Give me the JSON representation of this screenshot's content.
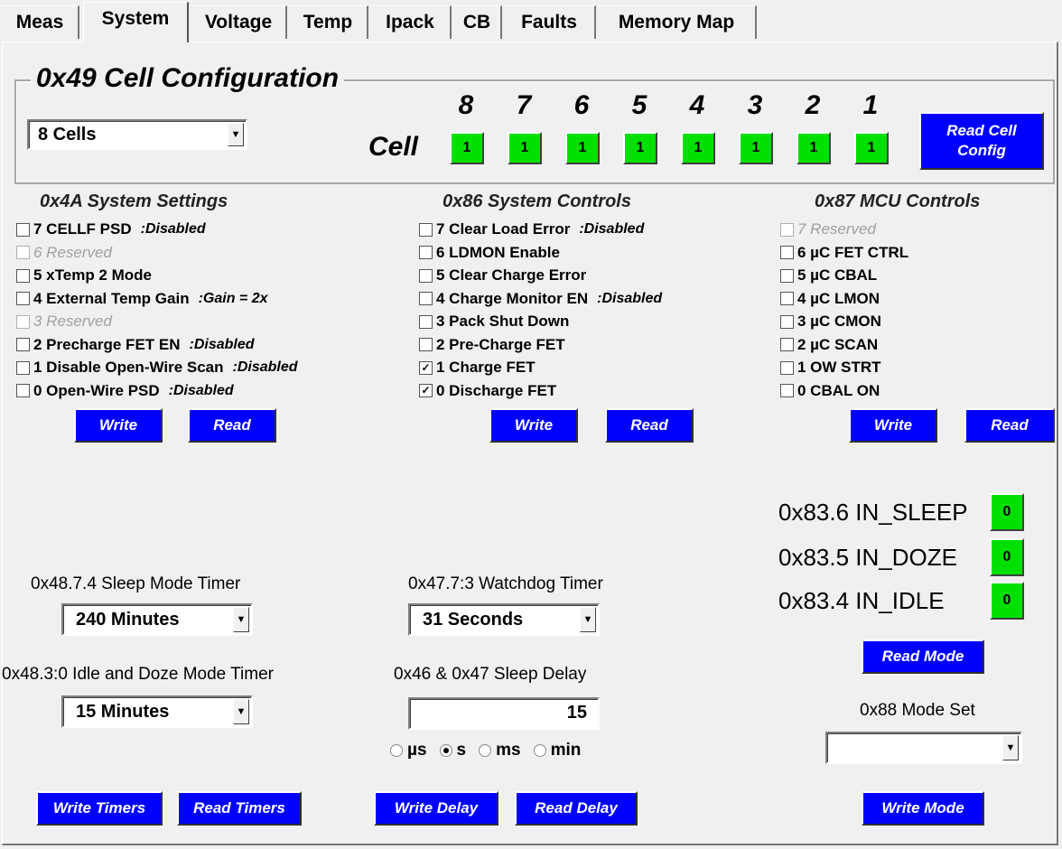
{
  "tabs": [
    "Meas",
    "System",
    "Voltage",
    "Temp",
    "Ipack",
    "CB",
    "Faults",
    "Memory Map"
  ],
  "active_tab": "System",
  "cell_config": {
    "title": "0x49 Cell Configuration",
    "cells_select": "8 Cells",
    "cell_label": "Cell",
    "cell_numbers": [
      "8",
      "7",
      "6",
      "5",
      "4",
      "3",
      "2",
      "1"
    ],
    "cell_values": [
      "1",
      "1",
      "1",
      "1",
      "1",
      "1",
      "1",
      "1"
    ],
    "read_button": "Read Cell Config"
  },
  "system_settings": {
    "title": "0x4A System Settings",
    "items": [
      {
        "label": "7 CELLF PSD",
        "note": ":Disabled",
        "checked": false,
        "disabled": false
      },
      {
        "label": "6 Reserved",
        "note": "",
        "checked": false,
        "disabled": true
      },
      {
        "label": "5 xTemp 2 Mode",
        "note": "",
        "checked": false,
        "disabled": false
      },
      {
        "label": "4 External Temp Gain",
        "note": ":Gain = 2x",
        "checked": false,
        "disabled": false
      },
      {
        "label": "3 Reserved",
        "note": "",
        "checked": false,
        "disabled": true
      },
      {
        "label": "2 Precharge FET EN",
        "note": ":Disabled",
        "checked": false,
        "disabled": false
      },
      {
        "label": "1 Disable Open-Wire Scan",
        "note": ":Disabled",
        "checked": false,
        "disabled": false
      },
      {
        "label": "0 Open-Wire PSD",
        "note": ":Disabled",
        "checked": false,
        "disabled": false
      }
    ],
    "write": "Write",
    "read": "Read"
  },
  "system_controls": {
    "title": "0x86 System Controls",
    "items": [
      {
        "label": "7 Clear Load Error",
        "note": ":Disabled",
        "checked": false,
        "disabled": false
      },
      {
        "label": "6 LDMON Enable",
        "note": "",
        "checked": false,
        "disabled": false
      },
      {
        "label": "5 Clear Charge Error",
        "note": "",
        "checked": false,
        "disabled": false
      },
      {
        "label": "4 Charge Monitor EN",
        "note": ":Disabled",
        "checked": false,
        "disabled": false
      },
      {
        "label": "3 Pack Shut Down",
        "note": "",
        "checked": false,
        "disabled": false
      },
      {
        "label": "2 Pre-Charge FET",
        "note": "",
        "checked": false,
        "disabled": false
      },
      {
        "label": "1 Charge FET",
        "note": "",
        "checked": true,
        "disabled": false
      },
      {
        "label": "0 Discharge FET",
        "note": "",
        "checked": true,
        "disabled": false
      }
    ],
    "write": "Write",
    "read": "Read"
  },
  "mcu_controls": {
    "title": "0x87 MCU Controls",
    "items": [
      {
        "label": "7 Reserved",
        "note": "",
        "checked": false,
        "disabled": true
      },
      {
        "label": "6 µC FET CTRL",
        "note": "",
        "checked": false,
        "disabled": false
      },
      {
        "label": "5 µC CBAL",
        "note": "",
        "checked": false,
        "disabled": false
      },
      {
        "label": "4 µC LMON",
        "note": "",
        "checked": false,
        "disabled": false
      },
      {
        "label": "3 µC CMON",
        "note": "",
        "checked": false,
        "disabled": false
      },
      {
        "label": "2 µC SCAN",
        "note": "",
        "checked": false,
        "disabled": false
      },
      {
        "label": "1 OW STRT",
        "note": "",
        "checked": false,
        "disabled": false
      },
      {
        "label": "0 CBAL ON",
        "note": "",
        "checked": false,
        "disabled": false
      }
    ],
    "write": "Write",
    "read": "Read"
  },
  "modes": {
    "in_sleep_label": "0x83.6 IN_SLEEP",
    "in_sleep": "0",
    "in_doze_label": "0x83.5 IN_DOZE",
    "in_doze": "0",
    "in_idle_label": "0x83.4 IN_IDLE",
    "in_idle": "0",
    "read_mode": "Read Mode",
    "mode_set_label": "0x88 Mode Set",
    "mode_set_value": "",
    "write_mode": "Write Mode"
  },
  "timers": {
    "sleep_timer_label": "0x48.7.4 Sleep Mode Timer",
    "sleep_timer_value": "240 Minutes",
    "idle_timer_label": "0x48.3:0 Idle and Doze Mode Timer",
    "idle_timer_value": "15 Minutes",
    "write_timers": "Write Timers",
    "read_timers": "Read Timers"
  },
  "watchdog": {
    "label": "0x47.7:3 Watchdog Timer",
    "value": "31 Seconds",
    "sleep_delay_label": "0x46 & 0x47 Sleep Delay",
    "sleep_delay_value": "15",
    "units": [
      "µs",
      "s",
      "ms",
      "min"
    ],
    "selected_unit": "s",
    "write_delay": "Write Delay",
    "read_delay": "Read Delay"
  }
}
